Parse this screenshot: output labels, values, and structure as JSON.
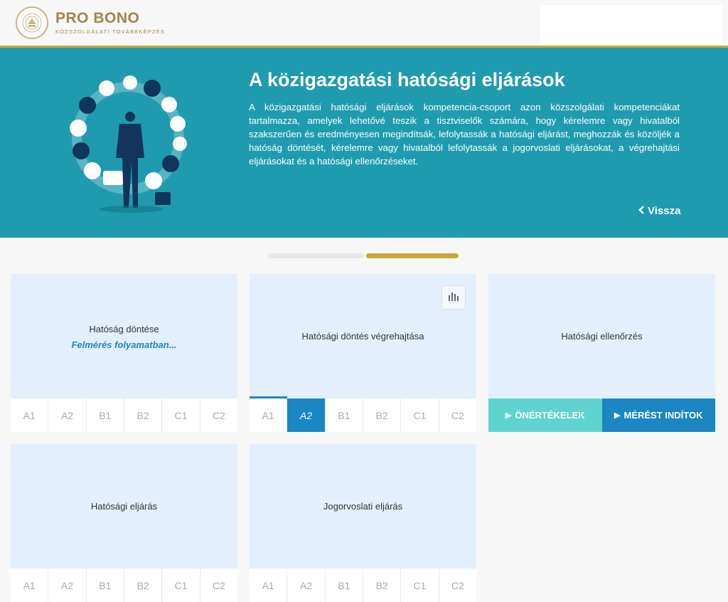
{
  "header": {
    "logo_title": "PRO BONO",
    "logo_subtitle": "KÖZSZOLGÁLATI TOVÁBBKÉPZÉS"
  },
  "hero": {
    "title": "A közigazgatási hatósági eljárások",
    "description": "A közigazgatási hatósági eljárások kompetencia-csoport azon közszolgálati kompetenciákat tartalmazza, amelyek lehetővé teszik a tisztviselők számára, hogy kérelemre vagy hivatalból szakszerűen és eredményesen megindítsák, lefolytassák a hatósági eljárást, meghozzák és közöljék a hatóság döntését, kérelemre vagy hivatalból lefolytassák a jogorvoslati eljárásokat, a végrehajtási eljárásokat és a hatósági ellenőrzéseket.",
    "back_label": "Vissza"
  },
  "levels": [
    "A1",
    "A2",
    "B1",
    "B2",
    "C1",
    "C2"
  ],
  "cards": [
    {
      "title": "Hatóság döntése",
      "status": "Felmérés folyamatban..."
    },
    {
      "title": "Hatósági döntés végrehajtása",
      "active_level": "A2"
    },
    {
      "title": "Hatósági ellenőrzés",
      "action_self": "ÖNÉRTÉKELEK",
      "action_start": "MÉRÉST INDÍTOK"
    },
    {
      "title": "Hatósági eljárás"
    },
    {
      "title": "Jogorvoslati eljárás"
    }
  ],
  "colors": {
    "teal": "#1f9bb0",
    "blue": "#1b86c4",
    "gold": "#c9a83a",
    "light_teal": "#5fd3cf",
    "card_bg": "#e3effc"
  }
}
